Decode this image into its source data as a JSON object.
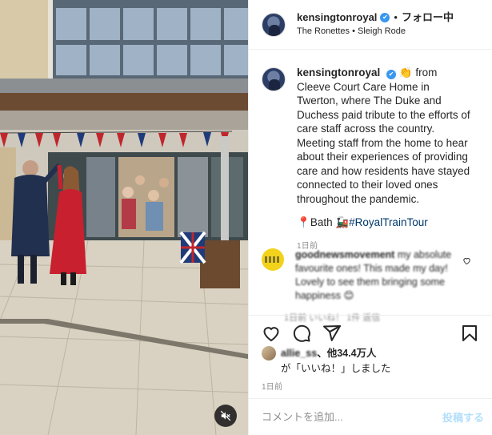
{
  "header": {
    "username": "kensingtonroyal",
    "separator": "•",
    "follow_label": "フォロー中",
    "subtitle": "The Ronettes • Sleigh Rode"
  },
  "caption": {
    "username": "kensingtonroyal",
    "emoji": "👏",
    "text": "from Cleeve Court Care Home in Twerton, where The Duke and Duchess paid tribute to the efforts of care staff across the country. Meeting staff from the home to hear about their experiences of providing care and how residents have stayed connected to their loved ones throughout the pandemic.",
    "location_pin": "📍",
    "location": "Bath",
    "train_emoji": "🚂",
    "hashtag": "#RoyalTrainTour",
    "time": "1日前"
  },
  "comment": {
    "username": "goodnewsmovement",
    "text": "my absolute favourite ones! This made my day! Lovely to see them bringing some happiness",
    "emoji": "😊",
    "meta": "1日前  いいね！ 1件  返信"
  },
  "likes": {
    "liker": "allie_ss",
    "count_text": "、他34.4万人",
    "suffix": "が「いいね！」しました"
  },
  "post_time": "1日前",
  "add_comment": {
    "placeholder": "コメントを追加...",
    "post_label": "投稿する"
  },
  "colors": {
    "verified": "#3897f0",
    "hashtag": "#00376b",
    "post_button_disabled": "#b2dffc",
    "muted_text": "#8e8e8e"
  },
  "icons": [
    "verified-badge-icon",
    "heart-icon",
    "comment-icon",
    "share-icon",
    "bookmark-icon",
    "mute-icon"
  ]
}
